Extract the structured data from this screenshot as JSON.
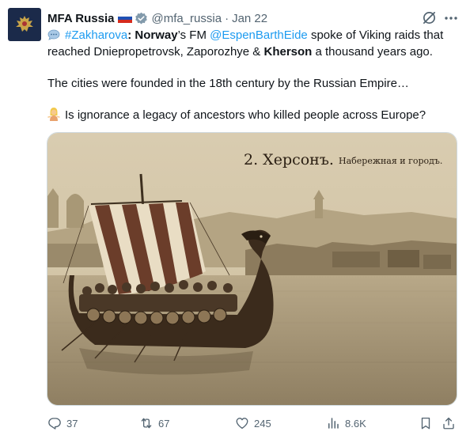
{
  "account": {
    "name": "MFA Russia",
    "flag": "russia-flag",
    "verified": "verified-badge",
    "handle": "@mfa_russia",
    "separator": "·",
    "date": "Jan 22"
  },
  "body": {
    "p1": {
      "emoji": "speech-bubble",
      "hashtag": "#Zakharova",
      "colon": ":",
      "country": "Norway",
      "t1": "’s FM ",
      "mention": "@EspenBarthEide",
      "t2": " spoke of Viking raids that reached Dniepropetrovsk, Zaporozhye & ",
      "city": "Kherson",
      "t3": " a thousand years ago."
    },
    "p2": "The cities were founded in the 18th century by the Russian Empire…",
    "p3": {
      "emoji": "person-shrugging",
      "text": "Is ignorance a legacy of ancestors who killed people across Europe?"
    }
  },
  "media": {
    "caption_number": "2. Херсонъ.",
    "caption_sub": "Набережная и городъ."
  },
  "actions": {
    "replies": "37",
    "reposts": "67",
    "likes": "245",
    "views": "8.6K"
  },
  "colors": {
    "link": "#1d9bf0",
    "muted": "#536471",
    "verified": "#829aab"
  }
}
